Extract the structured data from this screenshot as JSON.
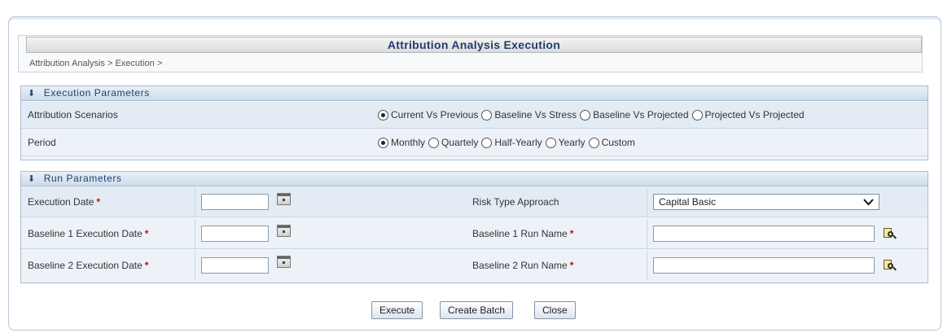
{
  "page": {
    "title": "Attribution Analysis Execution",
    "breadcrumb": "Attribution Analysis > Execution >"
  },
  "execution_parameters": {
    "header": "Execution Parameters",
    "scenarios": {
      "label": "Attribution Scenarios",
      "options": [
        "Current Vs Previous",
        "Baseline Vs Stress",
        "Baseline Vs Projected",
        "Projected Vs Projected"
      ],
      "selected": "Current Vs Previous"
    },
    "period": {
      "label": "Period",
      "options": [
        "Monthly",
        "Quartely",
        "Half-Yearly",
        "Yearly",
        "Custom"
      ],
      "selected": "Monthly"
    }
  },
  "run_parameters": {
    "header": "Run Parameters",
    "execution_date": {
      "label": "Execution Date",
      "value": ""
    },
    "risk_type_approach": {
      "label": "Risk Type Approach",
      "value": "Capital Basic"
    },
    "baseline1_execution_date": {
      "label": "Baseline 1 Execution Date",
      "value": ""
    },
    "baseline1_run_name": {
      "label": "Baseline 1 Run Name",
      "value": ""
    },
    "baseline2_execution_date": {
      "label": "Baseline 2 Execution Date",
      "value": ""
    },
    "baseline2_run_name": {
      "label": "Baseline 2 Run Name",
      "value": ""
    },
    "required_mark": "*"
  },
  "buttons": {
    "execute": "Execute",
    "create_batch": "Create Batch",
    "close": "Close"
  }
}
